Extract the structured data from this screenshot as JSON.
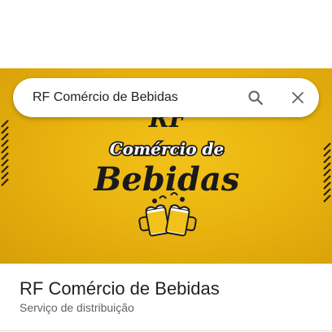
{
  "search": {
    "query": "RF Comércio de Bebidas",
    "search_icon": "search-icon",
    "close_icon": "close-icon"
  },
  "hero_image": {
    "logo_top_text": "RF",
    "logo_line1": "Comércio de",
    "logo_line2": "Bebidas",
    "logo_icon": "beer-mugs-icon",
    "background_color": "#e9b40f"
  },
  "place": {
    "title": "RF Comércio de Bebidas",
    "category": "Serviço de distribuição"
  }
}
